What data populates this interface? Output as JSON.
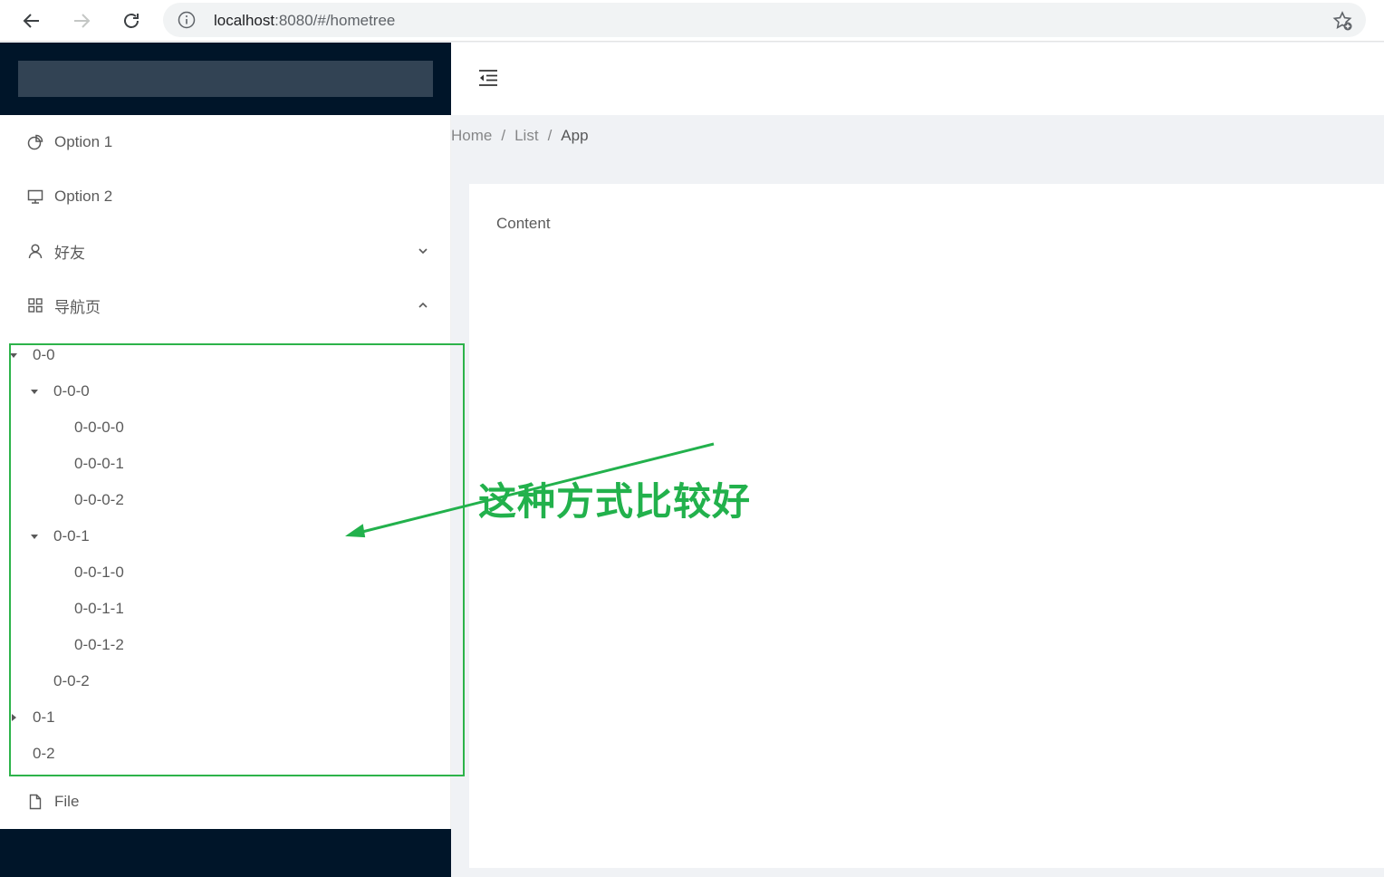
{
  "browser": {
    "url_host": "localhost",
    "url_rest": ":8080/#/hometree"
  },
  "sidebar": {
    "items": [
      {
        "label": "Option 1",
        "icon": "pie-chart-icon"
      },
      {
        "label": "Option 2",
        "icon": "desktop-icon"
      },
      {
        "label": "好友",
        "icon": "user-icon",
        "expanded": false
      },
      {
        "label": "导航页",
        "icon": "appstore-icon",
        "expanded": true
      },
      {
        "label": "File",
        "icon": "file-icon"
      }
    ],
    "tree": [
      {
        "label": "0-0",
        "expanded": true
      },
      {
        "label": "0-0-0",
        "expanded": true
      },
      {
        "label": "0-0-0-0"
      },
      {
        "label": "0-0-0-1"
      },
      {
        "label": "0-0-0-2"
      },
      {
        "label": "0-0-1",
        "expanded": true
      },
      {
        "label": "0-0-1-0"
      },
      {
        "label": "0-0-1-1"
      },
      {
        "label": "0-0-1-2"
      },
      {
        "label": "0-0-2"
      },
      {
        "label": "0-1",
        "expanded": false
      },
      {
        "label": "0-2"
      }
    ]
  },
  "breadcrumb": {
    "items": [
      "Home",
      "List",
      "App"
    ],
    "separator": "/"
  },
  "main": {
    "content_text": "Content"
  },
  "annotation": {
    "text": "这种方式比较好",
    "color": "#22b14c"
  }
}
